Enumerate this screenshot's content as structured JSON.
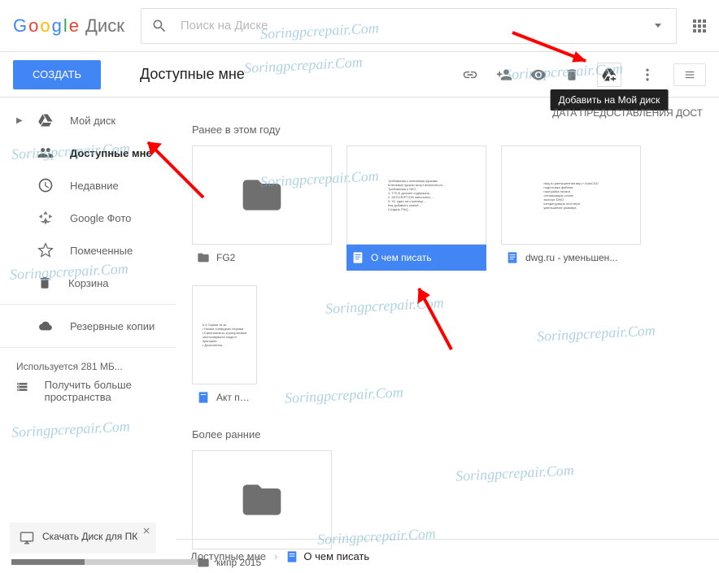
{
  "header": {
    "brand": "Google",
    "product": "Диск",
    "search_placeholder": "Поиск на Диске"
  },
  "toolbar": {
    "create_label": "СОЗДАТЬ",
    "page_title": "Доступные мне",
    "tooltip": "Добавить на Мой диск"
  },
  "column_header": "ДАТА ПРЕДОСТАВЛЕНИЯ ДОСТ",
  "sidebar": {
    "items": [
      {
        "label": "Мой диск",
        "icon": "drive",
        "expandable": true
      },
      {
        "label": "Доступные мне",
        "icon": "shared",
        "active": true
      },
      {
        "label": "Недавние",
        "icon": "clock"
      },
      {
        "label": "Google Фото",
        "icon": "photos"
      },
      {
        "label": "Помеченные",
        "icon": "star"
      },
      {
        "label": "Корзина",
        "icon": "trash"
      }
    ],
    "backups_label": "Резервные копии",
    "storage_used": "Используется 281 МБ...",
    "get_more_label": "Получить больше пространства"
  },
  "download_promo": "Скачать Диск для ПК",
  "sections": [
    {
      "label": "Ранее в этом году",
      "files": [
        {
          "name": "FG2",
          "type": "folder"
        },
        {
          "name": "О чем писать",
          "type": "doc",
          "selected": true
        },
        {
          "name": "dwg.ru - уменьшен...",
          "type": "doc"
        },
        {
          "name": "Акт перер",
          "type": "doc"
        }
      ]
    },
    {
      "label": "Более ранние",
      "files": [
        {
          "name": "кипр 2015",
          "type": "folder"
        }
      ]
    }
  ],
  "breadcrumb": {
    "root": "Доступные мне",
    "current": "О чем писать"
  },
  "watermark_text": "Soringpcrepair.Com"
}
